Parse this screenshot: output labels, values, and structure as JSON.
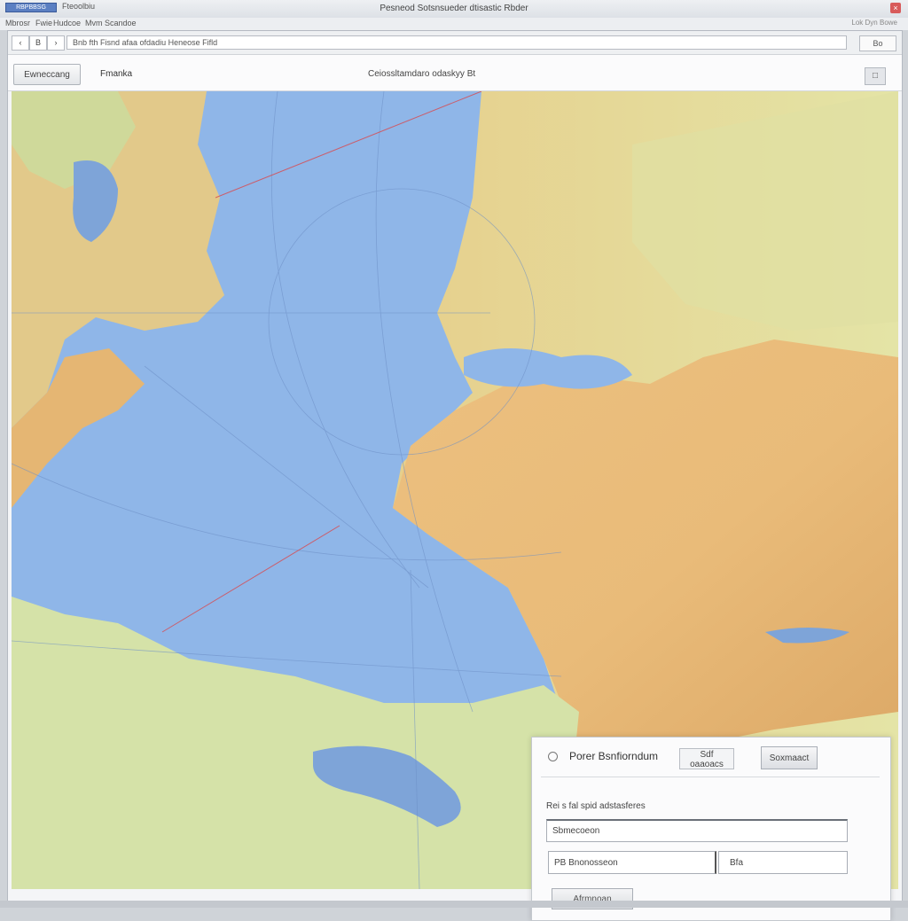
{
  "window": {
    "logo_text": "RBPBBSG",
    "left_label": "Fteoolbiu",
    "title": "Pesneod Sotsnsueder dtisastic Rbder",
    "close_glyph": "×"
  },
  "menu": {
    "items": [
      "Mbrosr",
      "Fwie",
      "Hudcoe",
      "Mvm",
      "Scandoe"
    ],
    "right_text": "Lok Dyn Bowe"
  },
  "toolbar": {
    "back_glyph": "‹",
    "home_glyph": "B",
    "forward_glyph": "›",
    "url_value": "Bnb fth Fisnd afaa ofdadiu Heneose Fifld",
    "right_button": "Bo"
  },
  "header": {
    "button_label": "Ewneccang",
    "label": "Fmanka",
    "center_text": "Ceiossltamdaro odaskyy Bt",
    "icon_glyph": "□"
  },
  "map": {
    "colors": {
      "ocean": "#8fb6e8",
      "land_arid": "#e8b878",
      "land_steppe": "#e7d995",
      "land_green": "#d5e2a8",
      "lake": "#7ea4d8"
    }
  },
  "panel": {
    "title": "Porer Bsnfiorndum",
    "button_one": "Sdf oaaoacs",
    "button_two": "Soxmaact",
    "form_label": "Rei s fal spid adstasferes",
    "field_one_value": "Sbmecoeon",
    "field_two_value": "PB Bnonosseon",
    "field_three_value": "Bfa",
    "submit_label": "Afrmnoan"
  }
}
